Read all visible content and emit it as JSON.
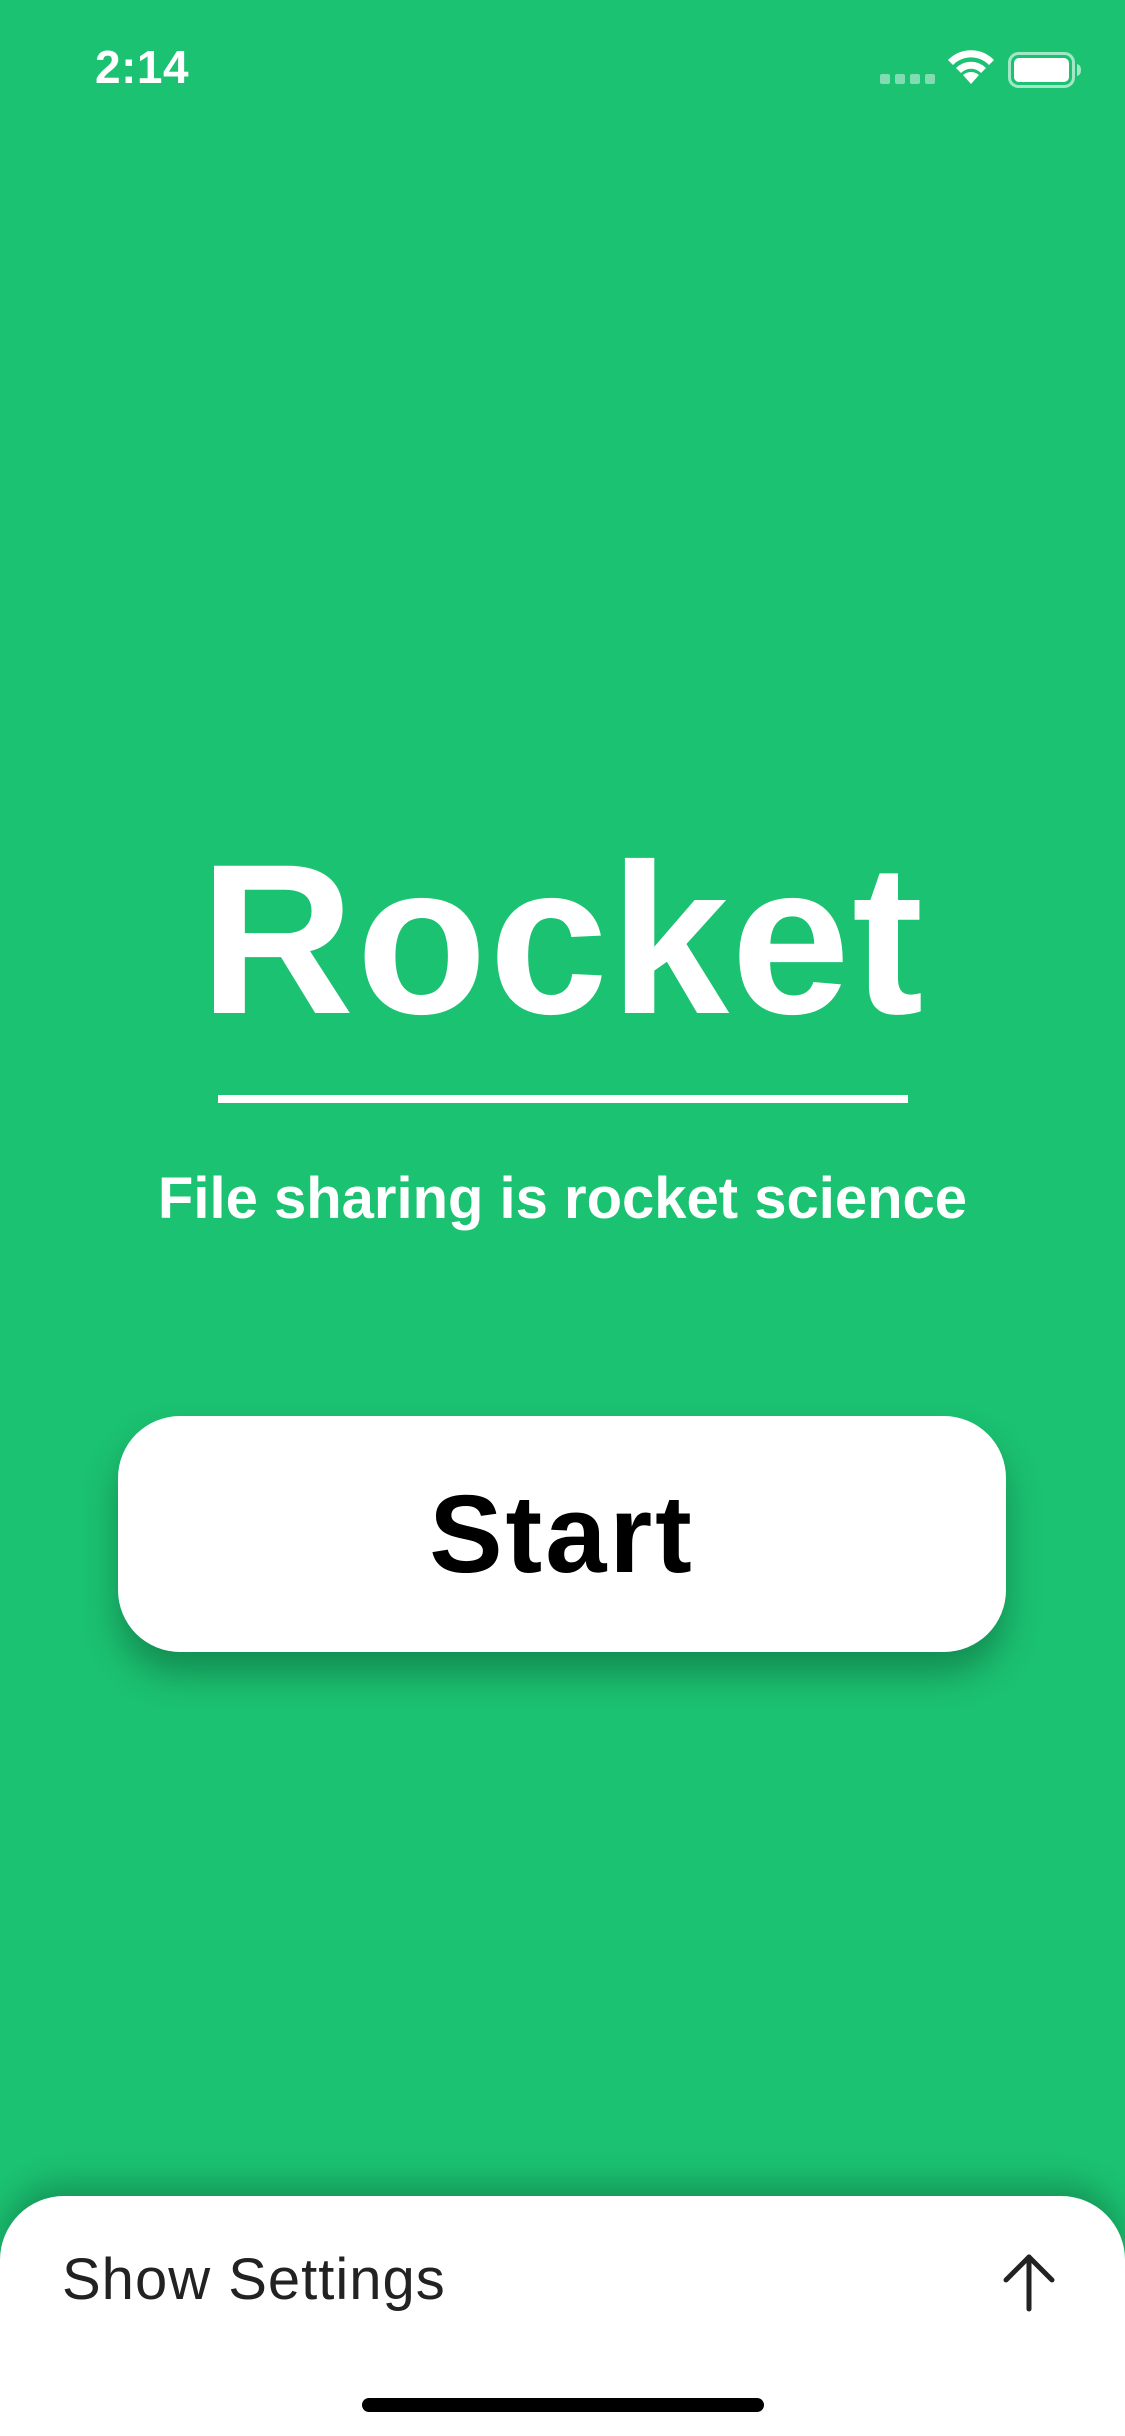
{
  "status_bar": {
    "time": "2:14",
    "signal_icon": "cellular-signal-icon",
    "wifi_icon": "wifi-icon",
    "battery_icon": "battery-icon"
  },
  "main": {
    "title": "Rocket",
    "tagline": "File sharing is rocket science",
    "start_button_label": "Start"
  },
  "bottom_sheet": {
    "settings_label": "Show Settings",
    "toggle_icon": "arrow-up-icon"
  },
  "colors": {
    "background": "#1bc271",
    "surface": "#ffffff",
    "text_dark": "#000000"
  }
}
